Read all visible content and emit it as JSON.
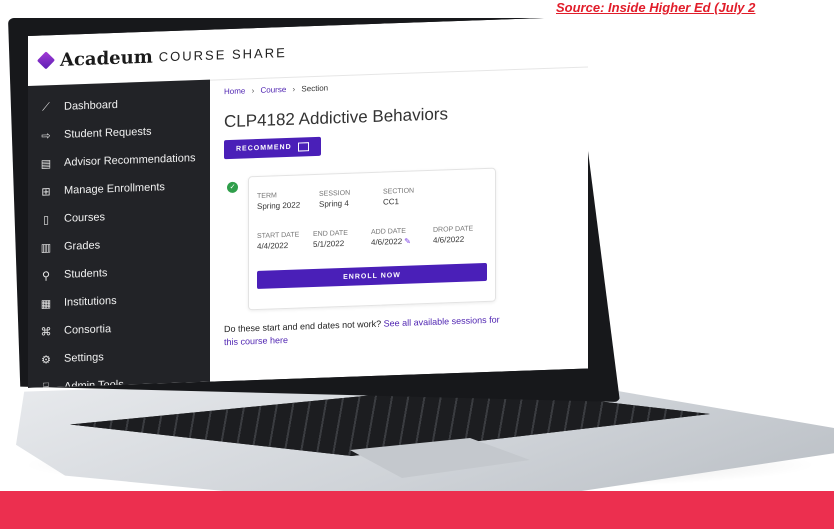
{
  "source_text": "Source: Inside Higher Ed (July 2",
  "brand": {
    "name": "Acadeum",
    "sub": "COURSE SHARE"
  },
  "sidebar": {
    "items": [
      {
        "label": "Dashboard",
        "icon": "chart-line-icon"
      },
      {
        "label": "Student Requests",
        "icon": "share-arrow-icon"
      },
      {
        "label": "Advisor Recommendations",
        "icon": "recommend-card-icon"
      },
      {
        "label": "Manage Enrollments",
        "icon": "enrollments-icon"
      },
      {
        "label": "Courses",
        "icon": "book-icon"
      },
      {
        "label": "Grades",
        "icon": "grades-icon"
      },
      {
        "label": "Students",
        "icon": "students-icon"
      },
      {
        "label": "Institutions",
        "icon": "building-icon"
      },
      {
        "label": "Consortia",
        "icon": "network-icon"
      },
      {
        "label": "Settings",
        "icon": "gear-icon"
      },
      {
        "label": "Admin Tools",
        "icon": "toolbox-icon"
      }
    ]
  },
  "breadcrumb": {
    "home": "Home",
    "course": "Course",
    "section": "Section",
    "sep": "›"
  },
  "page_title": "CLP4182 Addictive Behaviors",
  "recommend_label": "RECOMMEND",
  "card": {
    "term_label": "TERM",
    "term_value": "Spring 2022",
    "session_label": "SESSION",
    "session_value": "Spring 4",
    "section_label": "SECTION",
    "section_value": "CC1",
    "start_label": "START DATE",
    "start_value": "4/4/2022",
    "end_label": "END DATE",
    "end_value": "5/1/2022",
    "add_label": "ADD DATE",
    "add_value": "4/6/2022",
    "drop_label": "DROP DATE",
    "drop_value": "4/6/2022",
    "enroll_label": "ENROLL NOW"
  },
  "footnote": {
    "text": "Do these start and end dates not work? ",
    "link": "See all available sessions for this course here"
  },
  "colors": {
    "accent": "#4a1fb8",
    "sidebar": "#222327",
    "band": "#ec2f4f",
    "check": "#2f9e4a"
  }
}
